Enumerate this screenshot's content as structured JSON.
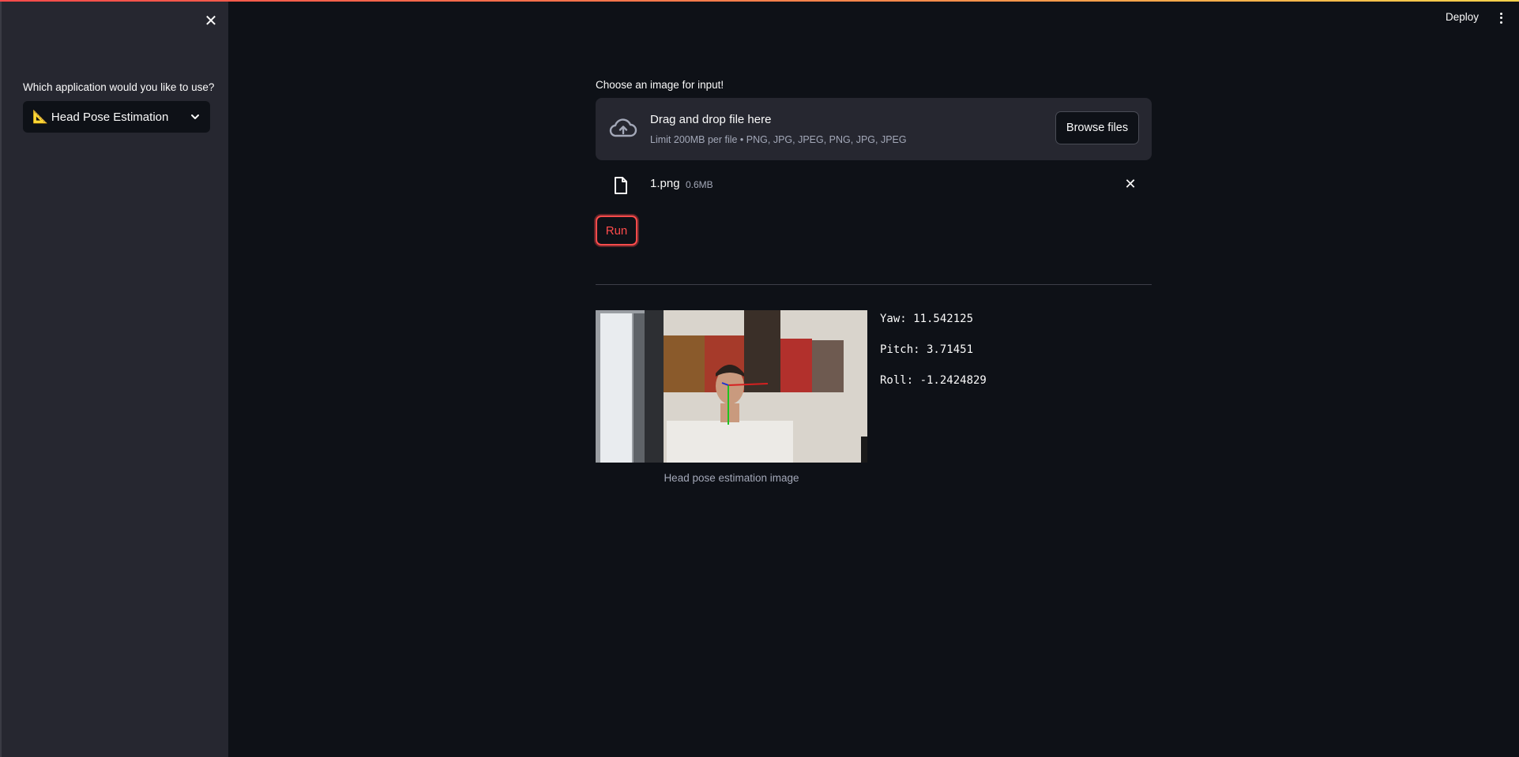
{
  "sidebar": {
    "select_label": "Which application would you like to use?",
    "selected_app": "Head Pose Estimation",
    "selected_icon": "triangular-ruler-icon"
  },
  "header": {
    "deploy_label": "Deploy"
  },
  "uploader": {
    "label": "Choose an image for input!",
    "drop_title": "Drag and drop file here",
    "drop_subtitle": "Limit 200MB per file • PNG, JPG, JPEG, PNG, JPG, JPEG",
    "browse_label": "Browse files",
    "file_name": "1.png",
    "file_size": "0.6MB"
  },
  "run_label": "Run",
  "result": {
    "caption": "Head pose estimation image",
    "yaw": "Yaw: 11.542125",
    "pitch": "Pitch: 3.71451",
    "roll": "Roll: -1.2424829"
  },
  "colors": {
    "background": "#0e1117",
    "sidebar": "#262730",
    "accent": "#ff4b4b"
  }
}
